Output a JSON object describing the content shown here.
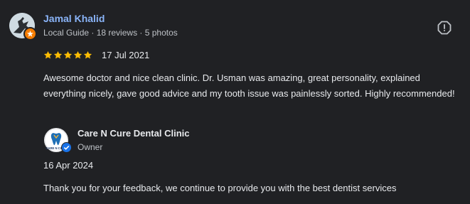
{
  "reviewer": {
    "name": "Jamal Khalid",
    "meta": "Local Guide · 18 reviews · 5 photos",
    "avatar_icon": "avatar-icon",
    "badge_icon": "local-guide-badge-icon"
  },
  "review": {
    "rating": 5,
    "max_rating": 5,
    "date": "17 Jul 2021",
    "text": "Awesome doctor and nice clean clinic. Dr. Usman was amazing, great personality, explained everything nicely, gave good advice and my tooth issue was painlessly sorted. Highly recommended!",
    "report_icon": "report-icon"
  },
  "owner_response": {
    "business_name": "Care N Cure Dental Clinic",
    "role": "Owner",
    "date": "16 Apr 2024",
    "text": "Thank you for your feedback, we continue to provide you with the best dentist services",
    "logo_text": "CARE N CURE",
    "verified_icon": "verified-icon"
  },
  "colors": {
    "background": "#202124",
    "name_link": "#8ab4f8",
    "star": "#fbbc04",
    "text_primary": "#e8eaed",
    "text_secondary": "#bdc1c6",
    "guide_badge": "#f57c00",
    "verified": "#1a73e8"
  }
}
